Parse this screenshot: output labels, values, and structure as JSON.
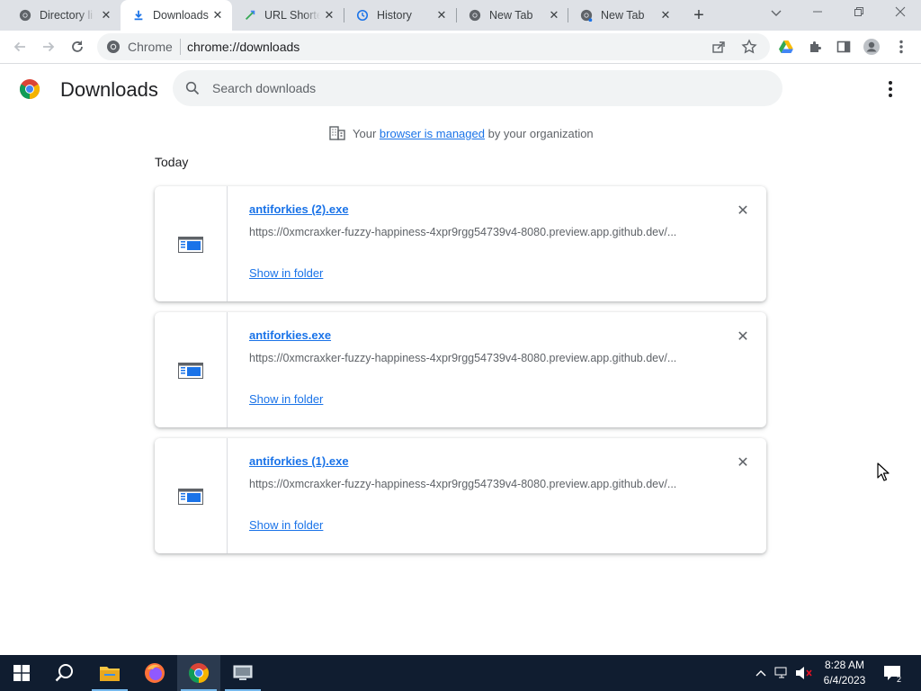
{
  "tabs": [
    {
      "title": "Directory li",
      "icon": "chrome-globe-icon",
      "active": false
    },
    {
      "title": "Downloads",
      "icon": "download-icon",
      "active": true
    },
    {
      "title": "URL Shorte",
      "icon": "url-shortener-icon",
      "active": false
    },
    {
      "title": "History",
      "icon": "history-icon",
      "active": false
    },
    {
      "title": "New Tab",
      "icon": "chrome-globe-icon",
      "active": false
    },
    {
      "title": "New Tab",
      "icon": "chrome-globe-icon",
      "active": false
    }
  ],
  "omnibox": {
    "scheme_label": "Chrome",
    "url": "chrome://downloads"
  },
  "page": {
    "title": "Downloads",
    "search_placeholder": "Search downloads",
    "managed_prefix": "Your",
    "managed_link": "browser is managed",
    "managed_suffix": "by your organization",
    "section_label": "Today"
  },
  "downloads": [
    {
      "filename": "antiforkies (2).exe",
      "url": "https://0xmcraxker-fuzzy-happiness-4xpr9rgg54739v4-8080.preview.app.github.dev/...",
      "action": "Show in folder"
    },
    {
      "filename": "antiforkies.exe",
      "url": "https://0xmcraxker-fuzzy-happiness-4xpr9rgg54739v4-8080.preview.app.github.dev/...",
      "action": "Show in folder"
    },
    {
      "filename": "antiforkies (1).exe",
      "url": "https://0xmcraxker-fuzzy-happiness-4xpr9rgg54739v4-8080.preview.app.github.dev/...",
      "action": "Show in folder"
    }
  ],
  "taskbar": {
    "time": "8:28 AM",
    "date": "6/4/2023",
    "notification_count": "2"
  },
  "colors": {
    "accent": "#1a73e8",
    "tabstrip": "#dee1e6",
    "taskbar": "#101d30"
  }
}
